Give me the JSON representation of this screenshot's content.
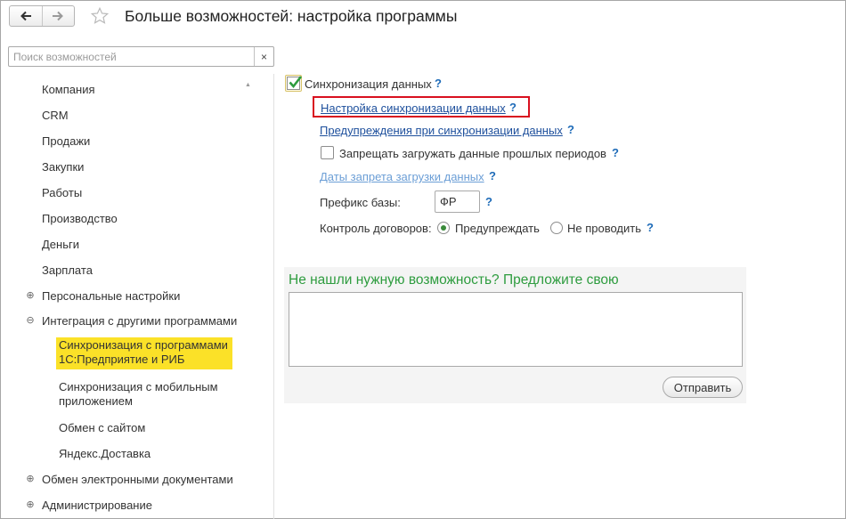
{
  "header": {
    "title": "Больше возможностей: настройка программы",
    "back_icon": "arrow-left-icon",
    "forward_icon": "arrow-right-icon",
    "favorite_icon": "star-icon"
  },
  "search": {
    "placeholder": "Поиск возможностей",
    "value": "",
    "clear": "×"
  },
  "sidebar": {
    "items": [
      "Компания",
      "CRM",
      "Продажи",
      "Закупки",
      "Работы",
      "Производство",
      "Деньги",
      "Зарплата",
      "Персональные настройки",
      "Интеграция с другими программами"
    ],
    "integration_children": [
      {
        "line1": "Синхронизация с программами",
        "line2": "1С:Предприятие и РИБ",
        "selected": true
      },
      {
        "line1": "Синхронизация с мобильным",
        "line2": "приложением",
        "selected": false
      },
      {
        "line1": "Обмен с сайтом",
        "line2": "",
        "selected": false
      },
      {
        "line1": "Яндекс.Доставка",
        "line2": "",
        "selected": false
      }
    ],
    "after_items": [
      "Обмен электронными документами",
      "Администрирование"
    ],
    "expand_symbol": "⊕",
    "collapse_symbol": "⊖"
  },
  "content": {
    "sync_label": "Синхронизация данных",
    "sync_checked": true,
    "link_sync_settings": "Настройка синхронизации данных",
    "link_sync_warnings": "Предупреждения при синхронизации данных",
    "forbid_label": "Запрещать загружать данные прошлых периодов",
    "forbid_checked": false,
    "link_dates": "Даты запрета загрузки данных",
    "prefix_label": "Префикс базы:",
    "prefix_value": "ФР",
    "contracts_label": "Контроль договоров:",
    "radio_warn": "Предупреждать",
    "radio_skip": "Не проводить",
    "help": "?"
  },
  "suggest": {
    "title": "Не нашли нужную возможность? Предложите свою",
    "text": "",
    "send_label": "Отправить"
  },
  "colors": {
    "selection": "#fbe128",
    "accent_green": "#2e9c3f",
    "link": "#1d4f9c",
    "highlight_frame": "#d9101f"
  }
}
